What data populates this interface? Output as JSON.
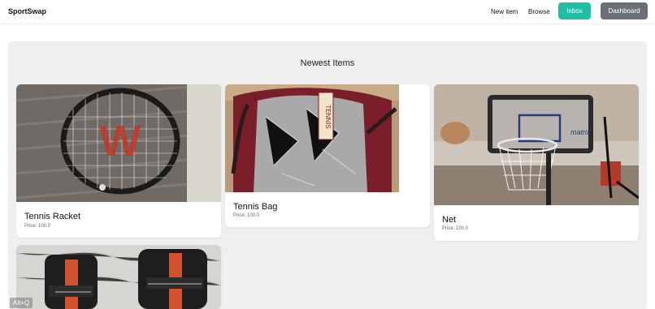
{
  "nav": {
    "brand": "SportSwap",
    "new_item": "New item",
    "browse": "Browse",
    "inbox": "Inbox",
    "dashboard": "Dashboard"
  },
  "main": {
    "section_title": "Newest Items",
    "items": [
      {
        "title": "Tennis Racket",
        "price": "Price: 100.0",
        "image": "tennis-racket-photo"
      },
      {
        "title": "Tennis Bag",
        "price": "Price: 100.0",
        "image": "tennis-bag-photo"
      },
      {
        "title": "Net",
        "price": "Price: 100.0",
        "image": "basketball-net-photo"
      },
      {
        "title": "",
        "price": "",
        "image": "dumbbells-photo"
      }
    ]
  },
  "overlay": {
    "label": "Alt+Q"
  }
}
